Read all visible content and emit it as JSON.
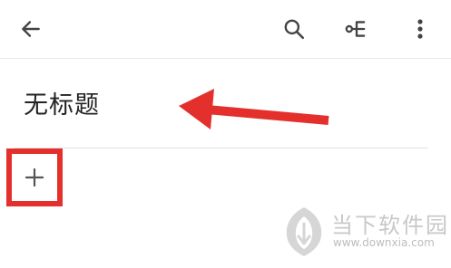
{
  "toolbar": {
    "back_icon": "arrow-left-icon",
    "search_icon": "search-icon",
    "mindmap_icon": "mindmap-tree-icon",
    "more_icon": "more-vertical-icon"
  },
  "document": {
    "title": "无标题"
  },
  "add_button": {
    "label": "+"
  },
  "annotation": {
    "color": "#e3302d"
  },
  "watermark": {
    "title": "当下软件园",
    "url": "www.downxia.com"
  }
}
